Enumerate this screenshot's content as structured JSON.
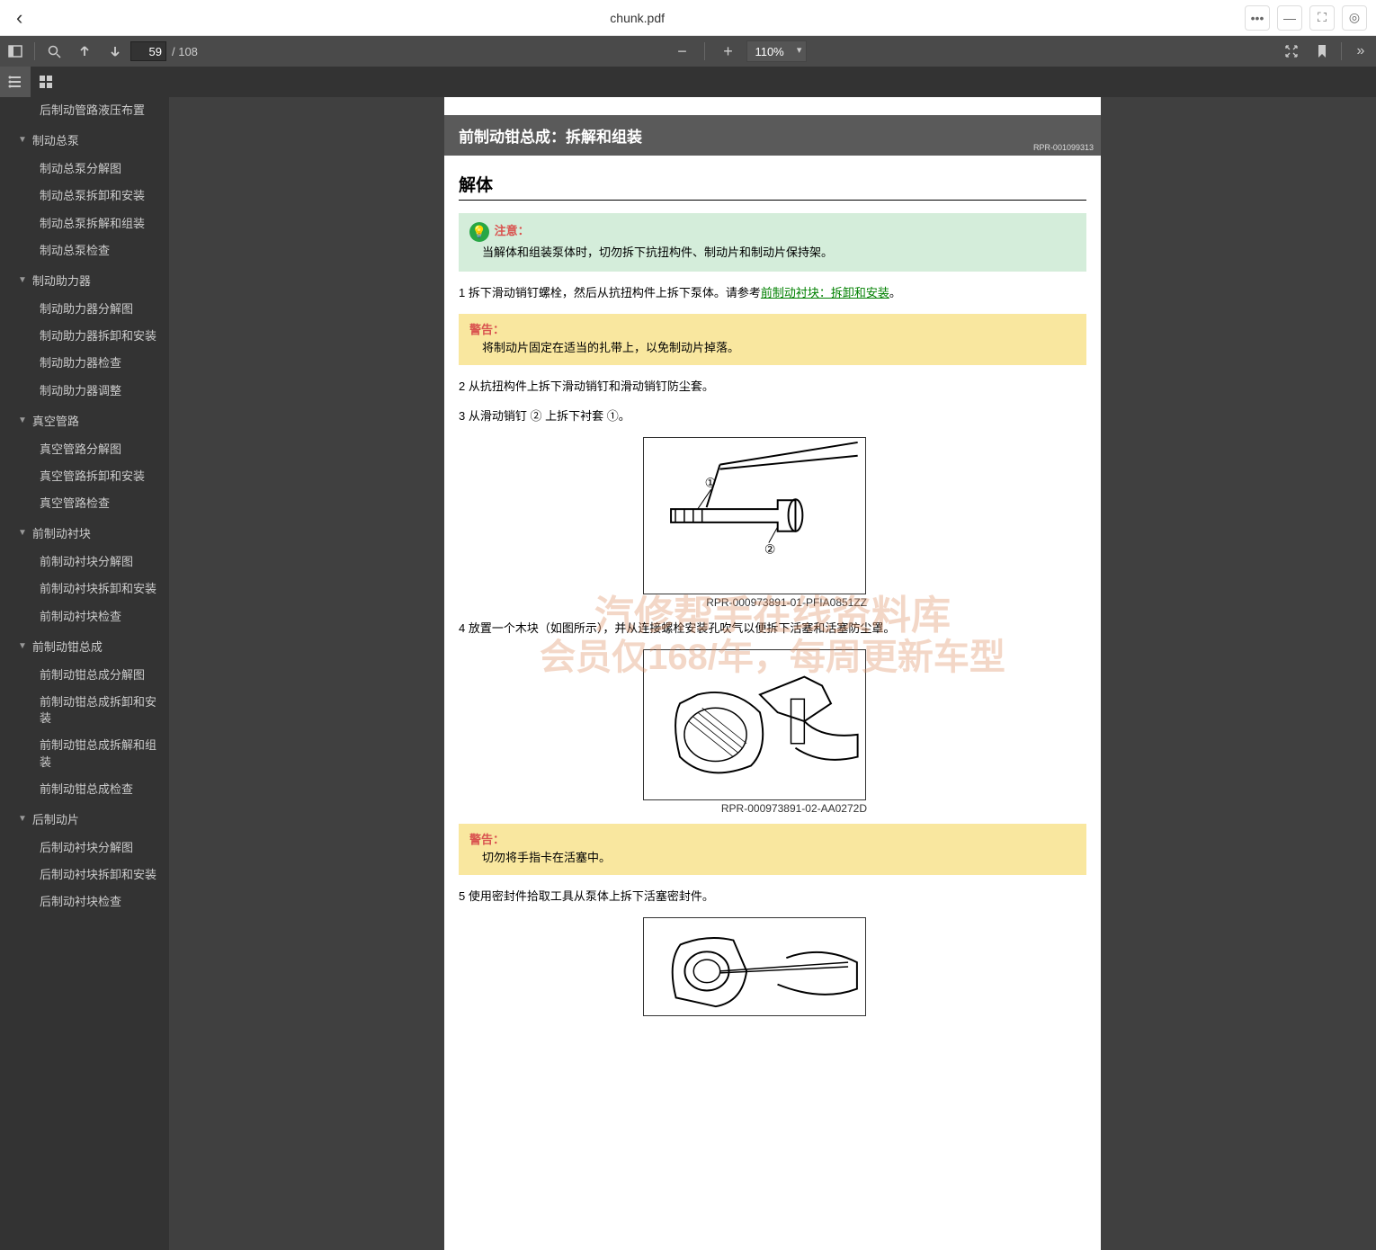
{
  "titlebar": {
    "title": "chunk.pdf"
  },
  "toolbar": {
    "page_current": "59",
    "page_total": "/ 108",
    "zoom_value": "110%"
  },
  "outline": [
    {
      "type": "child",
      "label": "后制动管路液压布置"
    },
    {
      "type": "parent",
      "label": "制动总泵"
    },
    {
      "type": "child",
      "label": "制动总泵分解图"
    },
    {
      "type": "child",
      "label": "制动总泵拆卸和安装"
    },
    {
      "type": "child",
      "label": "制动总泵拆解和组装"
    },
    {
      "type": "child",
      "label": "制动总泵检查"
    },
    {
      "type": "parent",
      "label": "制动助力器"
    },
    {
      "type": "child",
      "label": "制动助力器分解图"
    },
    {
      "type": "child",
      "label": "制动助力器拆卸和安装"
    },
    {
      "type": "child",
      "label": "制动助力器检查"
    },
    {
      "type": "child",
      "label": "制动助力器调整"
    },
    {
      "type": "parent",
      "label": "真空管路"
    },
    {
      "type": "child",
      "label": "真空管路分解图"
    },
    {
      "type": "child",
      "label": "真空管路拆卸和安装"
    },
    {
      "type": "child",
      "label": "真空管路检查"
    },
    {
      "type": "parent",
      "label": "前制动衬块"
    },
    {
      "type": "child",
      "label": "前制动衬块分解图"
    },
    {
      "type": "child",
      "label": "前制动衬块拆卸和安装"
    },
    {
      "type": "child",
      "label": "前制动衬块检查"
    },
    {
      "type": "parent",
      "label": "前制动钳总成"
    },
    {
      "type": "child",
      "label": "前制动钳总成分解图"
    },
    {
      "type": "child",
      "label": "前制动钳总成拆卸和安装"
    },
    {
      "type": "child",
      "label": "前制动钳总成拆解和组装"
    },
    {
      "type": "child",
      "label": "前制动钳总成检查"
    },
    {
      "type": "parent",
      "label": "后制动片"
    },
    {
      "type": "child",
      "label": "后制动衬块分解图"
    },
    {
      "type": "child",
      "label": "后制动衬块拆卸和安装"
    },
    {
      "type": "child",
      "label": "后制动衬块检查"
    }
  ],
  "doc": {
    "header_title": "前制动钳总成：拆解和组装",
    "header_ref": "RPR-001099313",
    "section_title": "解体",
    "note": {
      "label": "注意：",
      "text": "当解体和组装泵体时，切勿拆下抗扭构件、制动片和制动片保持架。"
    },
    "step1_prefix": "1 拆下滑动销钉螺栓，然后从抗扭构件上拆下泵体。请参考",
    "step1_link": "前制动衬块：拆卸和安装",
    "step1_suffix": "。",
    "warning1": {
      "label": "警告：",
      "text": "将制动片固定在适当的扎带上，以免制动片掉落。"
    },
    "step2": "2 从抗扭构件上拆下滑动销钉和滑动销钉防尘套。",
    "step3_a": "3 从滑动销钉 ",
    "step3_b": " 上拆下衬套 ",
    "step3_c": "。",
    "circ1": "①",
    "circ2": "②",
    "fig1_caption": "RPR-000973891-01-PFIA0851ZZ",
    "step4": "4 放置一个木块（如图所示），并从连接螺栓安装孔吹气以便拆下活塞和活塞防尘罩。",
    "fig2_caption": "RPR-000973891-02-AA0272D",
    "warning2": {
      "label": "警告：",
      "text": "切勿将手指卡在活塞中。"
    },
    "step5": "5 使用密封件拾取工具从泵体上拆下活塞密封件。",
    "watermark1": "汽修帮手在线资料库",
    "watermark2": "会员仅168/年，每周更新车型"
  }
}
